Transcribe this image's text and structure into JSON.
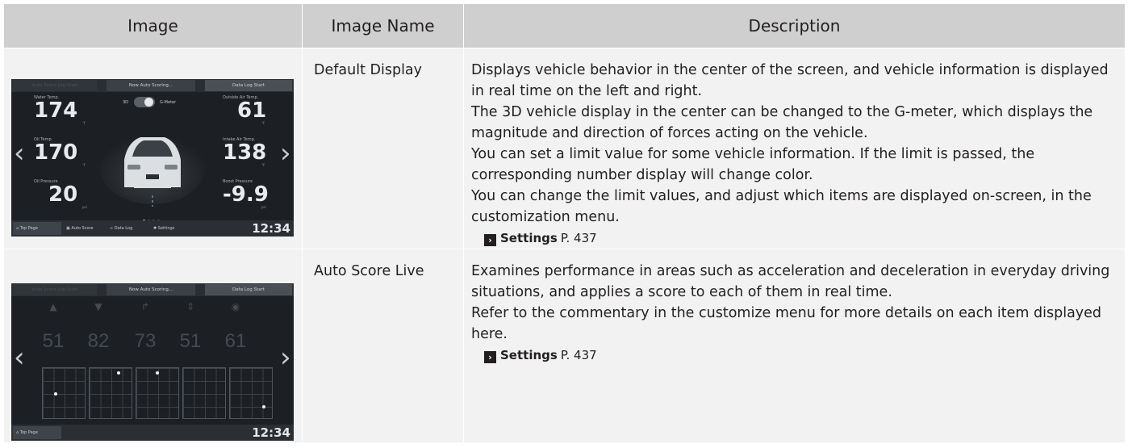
{
  "table": {
    "headers": [
      "Image",
      "Image Name",
      "Description"
    ],
    "rows": [
      {
        "name": "Default Display",
        "description": [
          "Displays vehicle behavior in the center of the screen, and vehicle information is displayed in real time on the left and right.",
          "The 3D vehicle display in the center can be changed to the G-meter, which displays the magnitude and direction of forces acting on the vehicle.",
          "You can set a limit value for some vehicle information. If the limit is passed, the corresponding number display will change color.",
          "You can change the limit values, and adjust which items are displayed on-screen, in the customization menu."
        ],
        "ref_label": "Settings",
        "ref_page": "P. 437"
      },
      {
        "name": "Auto Score Live",
        "description": [
          "Examines performance in areas such as acceleration and deceleration in everyday driving situations, and applies a score to each of them in real time.",
          "Refer to the commentary in the customize menu for more details on each item displayed here."
        ],
        "ref_label": "Settings",
        "ref_page": "P. 437"
      }
    ]
  },
  "screen1": {
    "top_bar": {
      "left": "Auto Score Log Start",
      "middle": "Now Auto Scoring...",
      "right": "Data Log Start"
    },
    "toggle_left": "3D",
    "toggle_right": "G-Meter",
    "gauges": [
      {
        "label": "Water Temp.",
        "value": "174",
        "unit": "°F"
      },
      {
        "label": "Oil Temp.",
        "value": "170",
        "unit": "°F"
      },
      {
        "label": "Oil Pressure",
        "value": "20",
        "unit": "psi"
      },
      {
        "label": "Outside Air Temp.",
        "value": "61",
        "unit": "°F"
      },
      {
        "label": "Intake Air Temp.",
        "value": "138",
        "unit": "°F"
      },
      {
        "label": "Boost Pressure",
        "value": "-9.9",
        "unit": "psi"
      }
    ],
    "bottom_bar": {
      "item1": "Top Page",
      "item2": "Auto Score",
      "item3": "Data Log",
      "item4": "Settings"
    },
    "clock": "12:34"
  },
  "screen2": {
    "top_bar": {
      "left": "Auto Score Log Start",
      "middle": "Now Auto Scoring...",
      "right": "Data Log Start"
    },
    "scores": [
      "51",
      "82",
      "73",
      "51",
      "61"
    ],
    "bottom_bar": {
      "item1": "Top Page"
    },
    "clock": "12:34"
  }
}
